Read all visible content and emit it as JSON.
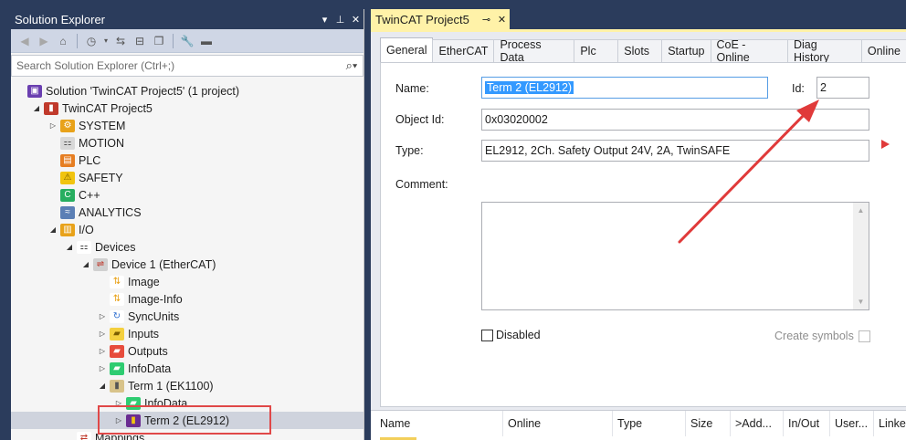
{
  "solution_explorer": {
    "title": "Solution Explorer",
    "title_controls": [
      "▾",
      "⊥",
      "✕"
    ],
    "search_placeholder": "Search Solution Explorer (Ctrl+;)",
    "tree": [
      {
        "label": "Solution 'TwinCAT Project5' (1 project)",
        "level": 0,
        "expander": "",
        "icon": "solution-icon"
      },
      {
        "label": "TwinCAT Project5",
        "level": 1,
        "expander": "◢",
        "icon": "twincat-project-icon"
      },
      {
        "label": "SYSTEM",
        "level": 2,
        "expander": "▷",
        "icon": "system-icon"
      },
      {
        "label": "MOTION",
        "level": 2,
        "expander": "",
        "icon": "motion-icon"
      },
      {
        "label": "PLC",
        "level": 2,
        "expander": "",
        "icon": "plc-icon"
      },
      {
        "label": "SAFETY",
        "level": 2,
        "expander": "",
        "icon": "safety-icon"
      },
      {
        "label": "C++",
        "level": 2,
        "expander": "",
        "icon": "cpp-icon"
      },
      {
        "label": "ANALYTICS",
        "level": 2,
        "expander": "",
        "icon": "analytics-icon"
      },
      {
        "label": "I/O",
        "level": 2,
        "expander": "◢",
        "icon": "io-icon"
      },
      {
        "label": "Devices",
        "level": 3,
        "expander": "◢",
        "icon": "devices-icon"
      },
      {
        "label": "Device 1 (EtherCAT)",
        "level": 4,
        "expander": "◢",
        "icon": "ethercat-device-icon"
      },
      {
        "label": "Image",
        "level": 5,
        "expander": "",
        "icon": "image-icon"
      },
      {
        "label": "Image-Info",
        "level": 5,
        "expander": "",
        "icon": "image-info-icon"
      },
      {
        "label": "SyncUnits",
        "level": 5,
        "expander": "▷",
        "icon": "syncunits-icon"
      },
      {
        "label": "Inputs",
        "level": 5,
        "expander": "▷",
        "icon": "inputs-icon"
      },
      {
        "label": "Outputs",
        "level": 5,
        "expander": "▷",
        "icon": "outputs-icon"
      },
      {
        "label": "InfoData",
        "level": 5,
        "expander": "▷",
        "icon": "infodata-icon"
      },
      {
        "label": "Term 1 (EK1100)",
        "level": 5,
        "expander": "◢",
        "icon": "terminal-icon"
      },
      {
        "label": "InfoData",
        "level": 6,
        "expander": "▷",
        "icon": "infodata-icon"
      },
      {
        "label": "Term 2 (EL2912)",
        "level": 6,
        "expander": "▷",
        "icon": "safety-terminal-icon",
        "selected": true
      },
      {
        "label": "Mappings",
        "level": 3,
        "expander": "",
        "icon": "mappings-icon"
      }
    ]
  },
  "document": {
    "tab_title": "TwinCAT Project5",
    "tab_controls": [
      "⊸",
      "✕"
    ],
    "tabs": [
      "General",
      "EtherCAT",
      "Process Data",
      "Plc",
      "Slots",
      "Startup",
      "CoE - Online",
      "Diag History",
      "Online"
    ],
    "active_tab": 0,
    "form": {
      "name_label": "Name:",
      "name_value": "Term 2 (EL2912)",
      "id_label": "Id:",
      "id_value": "2",
      "object_id_label": "Object Id:",
      "object_id_value": "0x03020002",
      "type_label": "Type:",
      "type_value": "EL2912, 2Ch. Safety Output 24V, 2A, TwinSAFE",
      "comment_label": "Comment:",
      "comment_value": "",
      "disabled_label": "Disabled",
      "create_symbols_label": "Create symbols"
    }
  },
  "grid": {
    "columns": [
      "Name",
      "Online",
      "Type",
      "Size",
      ">Add...",
      "In/Out",
      "User...",
      "Linke"
    ]
  },
  "colors": {
    "chrome": "#2b3c5c",
    "tab_yellow": "#fff2a8",
    "annotation_red": "#e03a3a",
    "selection_blue": "#3399ff"
  }
}
